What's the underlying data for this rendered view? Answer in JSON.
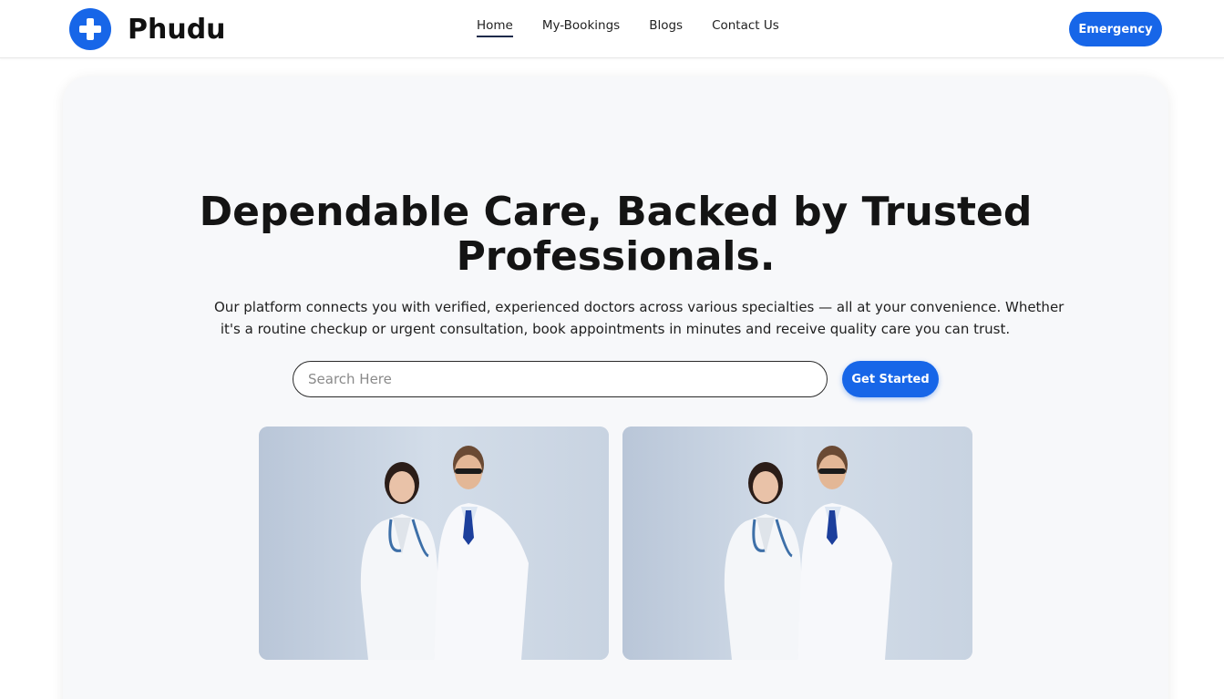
{
  "brand": {
    "name": "Phudu",
    "icon": "medical-cross-icon",
    "color": "#1766e8"
  },
  "nav": [
    {
      "label": "Home",
      "active": true
    },
    {
      "label": "My-Bookings",
      "active": false
    },
    {
      "label": "Blogs",
      "active": false
    },
    {
      "label": "Contact Us",
      "active": false
    }
  ],
  "header": {
    "emergency_label": "Emergency"
  },
  "hero": {
    "title_line1": "Dependable Care, Backed by Trusted",
    "title_line2": "Professionals.",
    "description_line1": "Our platform connects you with verified, experienced doctors across various specialties — all at your convenience. Whether",
    "description_line2": "it's a routine checkup or urgent consultation, book appointments in minutes and receive quality care you can trust.",
    "search_placeholder": "Search Here",
    "search_value": "",
    "cta_label": "Get Started"
  },
  "images": [
    {
      "subject": "two-doctors-photo"
    },
    {
      "subject": "two-doctors-photo"
    }
  ],
  "colors": {
    "accent": "#1766e8",
    "hero_bg": "#f7f8fa",
    "text": "#141414"
  }
}
